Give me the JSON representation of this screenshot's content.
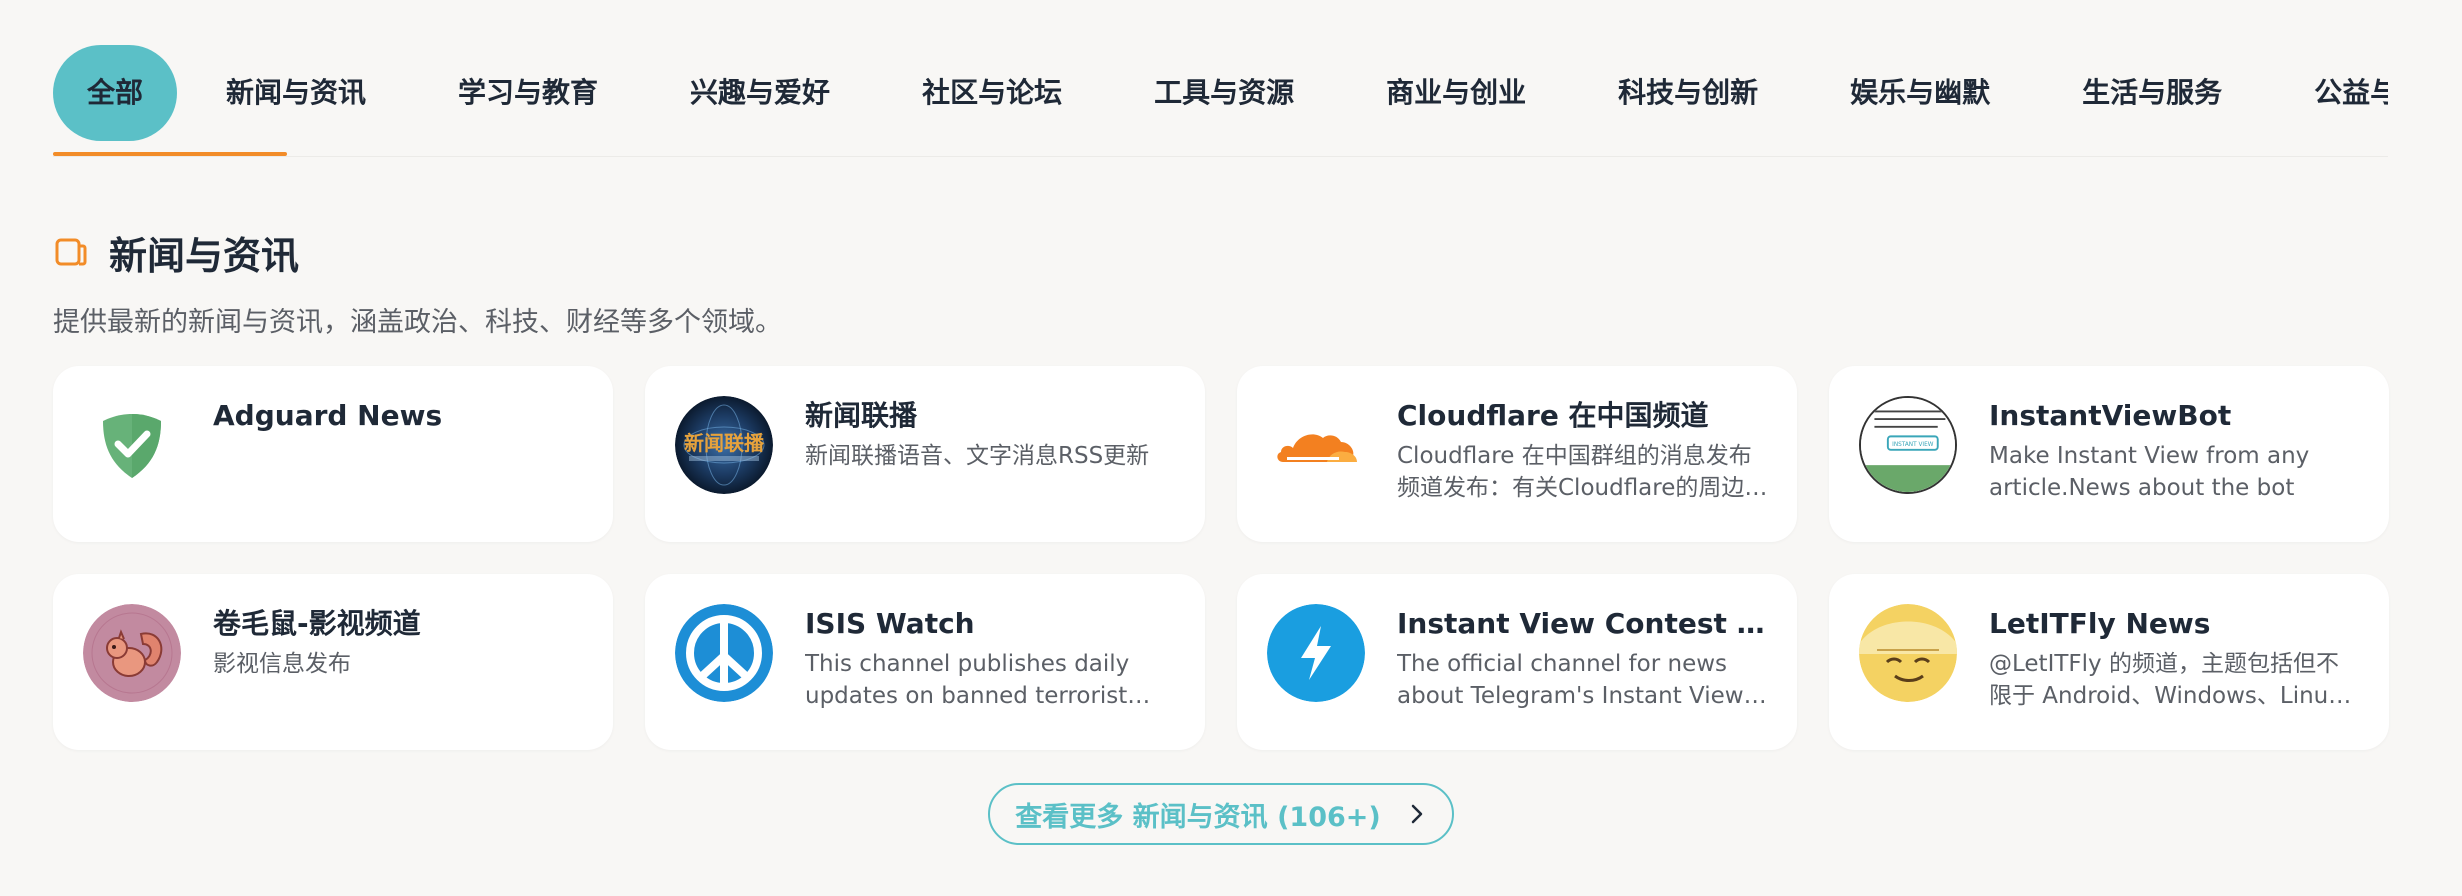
{
  "tabs": [
    {
      "label": "全部"
    },
    {
      "label": "新闻与资讯"
    },
    {
      "label": "学习与教育"
    },
    {
      "label": "兴趣与爱好"
    },
    {
      "label": "社区与论坛"
    },
    {
      "label": "工具与资源"
    },
    {
      "label": "商业与创业"
    },
    {
      "label": "科技与创新"
    },
    {
      "label": "娱乐与幽默"
    },
    {
      "label": "生活与服务"
    },
    {
      "label": "公益与可持续"
    }
  ],
  "active_tab": "全部",
  "section": {
    "title": "新闻与资讯",
    "icon": "folder-icon",
    "description": "提供最新的新闻与资讯，涵盖政治、科技、财经等多个领域。"
  },
  "cards": [
    {
      "title": "Adguard News",
      "description": "",
      "icon": "adguard-shield-icon"
    },
    {
      "title": "新闻联播",
      "description": "新闻联播语音、文字消息RSS更新",
      "icon": "xinwen-lianbo-logo",
      "logo_text": "新闻联播"
    },
    {
      "title": "Cloudflare 在中国频道",
      "description": "Cloudflare 在中国群组的消息发布频道发布：有关Cloudflare的周边信息",
      "icon": "cloudflare-cloud-icon"
    },
    {
      "title": "InstantViewBot",
      "description": "Make Instant View from any article.News about the bot",
      "icon": "instant-view-preview-icon",
      "logo_text": "INSTANT VIEW"
    },
    {
      "title": "卷毛鼠-影视频道",
      "description": "影视信息发布",
      "icon": "squirrel-icon"
    },
    {
      "title": "ISIS Watch",
      "description": "This channel publishes daily updates on banned terrorist content",
      "icon": "peace-sign-icon"
    },
    {
      "title": "Instant View Contest News",
      "description": "The official channel for news about Telegram's Instant View contest",
      "icon": "lightning-bolt-icon"
    },
    {
      "title": "LetITFly News",
      "description": "@LetITFly 的频道，主题包括但不限于 Android、Windows、Linux 等",
      "icon": "smiling-face-icon"
    }
  ],
  "more_button": {
    "label": "查看更多 新闻与资讯 (106+)",
    "icon": "chevron-right-icon"
  },
  "colors": {
    "accent": "#5bc0c7",
    "underline": "#f28c28",
    "background": "#f8f7f5"
  }
}
